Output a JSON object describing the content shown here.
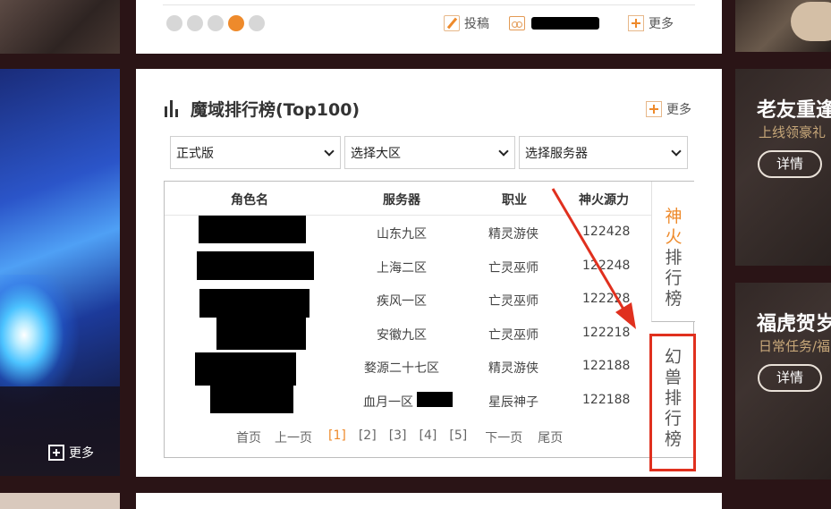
{
  "top_bar": {
    "submit_label": "投稿",
    "more_label": "更多"
  },
  "ranking": {
    "title": "魔域排行榜(Top100)",
    "more_label": "更多",
    "filters": {
      "version": "正式版",
      "region": "选择大区",
      "server": "选择服务器"
    },
    "columns": [
      "角色名",
      "服务器",
      "职业",
      "神火源力"
    ],
    "rows": [
      {
        "server": "山东九区",
        "class": "精灵游侠",
        "power": "122428"
      },
      {
        "server": "上海二区",
        "class": "亡灵巫师",
        "power": "122248"
      },
      {
        "server": "疾风一区",
        "class": "亡灵巫师",
        "power": "122228"
      },
      {
        "server": "安徽九区",
        "class": "亡灵巫师",
        "power": "122218"
      },
      {
        "server": "婺源二十七区",
        "class": "精灵游侠",
        "power": "122188"
      },
      {
        "server": "血月一区",
        "class": "星辰神子",
        "power": "122188"
      }
    ],
    "pager": {
      "first": "首页",
      "prev": "上一页",
      "pages": [
        "[1]",
        "[2]",
        "[3]",
        "[4]",
        "[5]"
      ],
      "next": "下一页",
      "last": "尾页"
    },
    "tabs": {
      "fire_hi": "神火",
      "fire_rest": "排行榜",
      "beast": "幻兽排行榜"
    }
  },
  "left_panel": {
    "more_label": "更多"
  },
  "promos": [
    {
      "title": "老友重逢",
      "subtitle": "上线领豪礼",
      "button": "详情"
    },
    {
      "title": "福虎贺岁",
      "subtitle": "日常任务/福",
      "button": "详情"
    }
  ],
  "colors": {
    "accent": "#ee8a2b",
    "highlight": "#e0301e",
    "background": "#2a1416"
  }
}
